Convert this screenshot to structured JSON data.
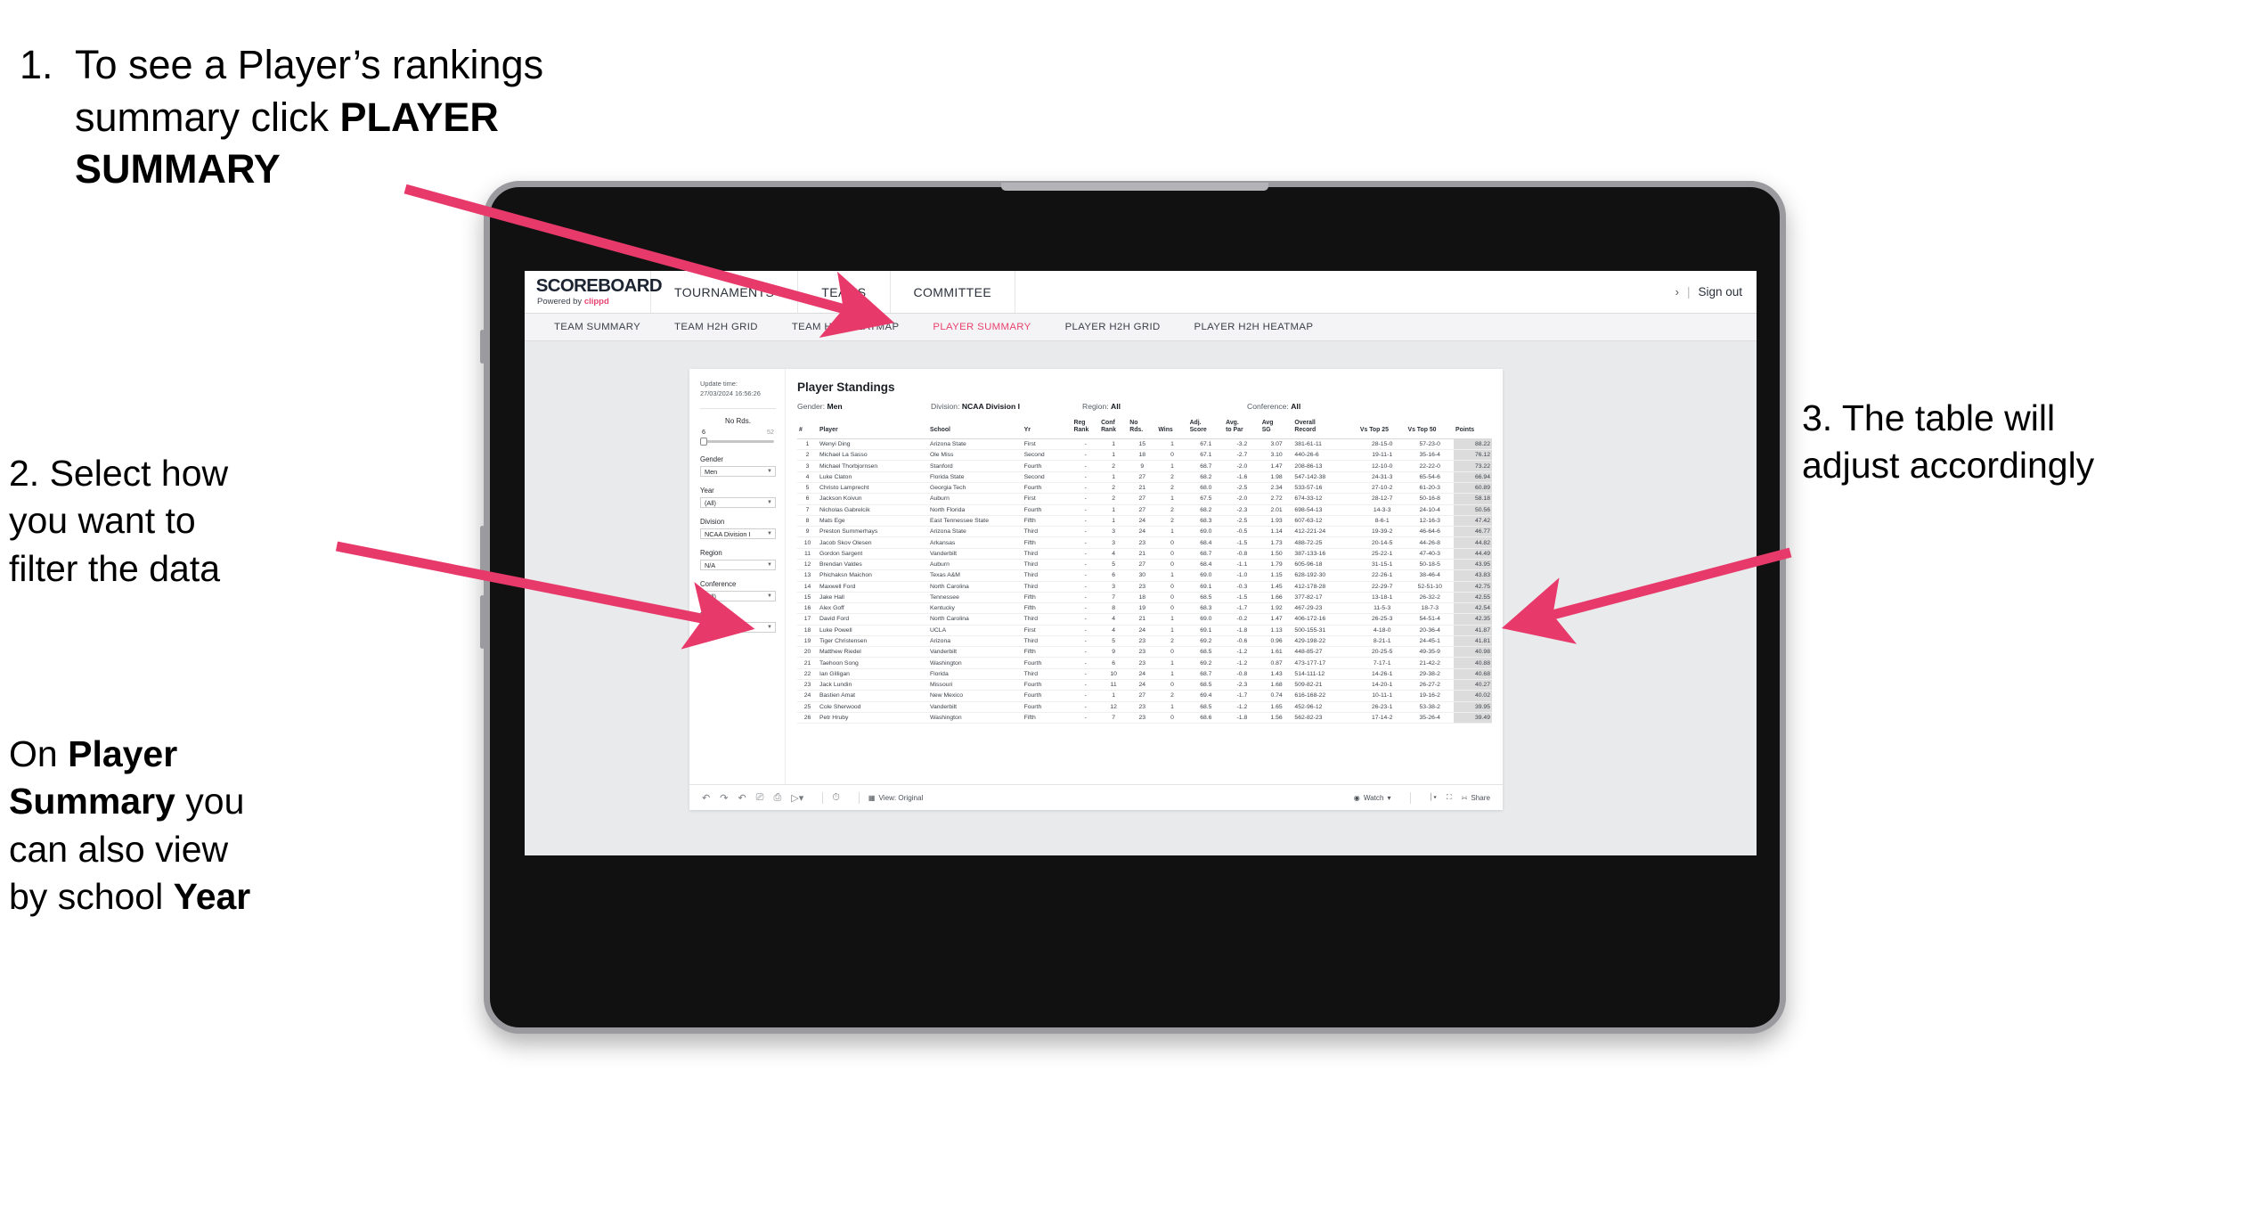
{
  "annotations": {
    "step1": {
      "number": "1.",
      "line1": "To see a Player’s rankings",
      "line2_pre": "summary click ",
      "line2_bold": "PLAYER",
      "line3_bold": "SUMMARY"
    },
    "step2": {
      "line1": "2. Select how",
      "line2": "you want to",
      "line3": "filter the data"
    },
    "step2b": {
      "pre1": "On ",
      "b1": "Player",
      "b2": "Summary",
      "post2": " you",
      "line3": "can also view",
      "line4_pre": "by school ",
      "line4_bold": "Year"
    },
    "step3": {
      "line1": "3. The table will",
      "line2": "adjust accordingly"
    },
    "arrow_color": "#e8396b"
  },
  "app": {
    "logo": {
      "word": "SCOREBOARD",
      "powered_by": "Powered by ",
      "brand": "clippd"
    },
    "top_nav": [
      "TOURNAMENTS",
      "TEAMS",
      "COMMITTEE"
    ],
    "top_right": {
      "chevron": "›",
      "separator": "|",
      "sign_out": "Sign out"
    },
    "sub_tabs": [
      {
        "label": "TEAM SUMMARY",
        "active": false
      },
      {
        "label": "TEAM H2H GRID",
        "active": false
      },
      {
        "label": "TEAM H2H HEATMAP",
        "active": false
      },
      {
        "label": "PLAYER SUMMARY",
        "active": true
      },
      {
        "label": "PLAYER H2H GRID",
        "active": false
      },
      {
        "label": "PLAYER H2H HEATMAP",
        "active": false
      }
    ]
  },
  "filters": {
    "update_label": "Update time:",
    "update_time": "27/03/2024 16:56:26",
    "slider": {
      "title": "No Rds.",
      "min": "6",
      "max": "52"
    },
    "controls": [
      {
        "label": "Gender",
        "value": "Men"
      },
      {
        "label": "Year",
        "value": "(All)"
      },
      {
        "label": "Division",
        "value": "NCAA Division I"
      },
      {
        "label": "Region",
        "value": "N/A"
      },
      {
        "label": "Conference",
        "value": "(All)"
      },
      {
        "label": "Player",
        "value": "(All)"
      }
    ]
  },
  "viz": {
    "title": "Player Standings",
    "filter_summary": [
      {
        "label": "Gender: ",
        "value": "Men"
      },
      {
        "label": "Division: ",
        "value": "NCAA Division I"
      },
      {
        "label": "Region: ",
        "value": "All"
      },
      {
        "label": "Conference: ",
        "value": "All"
      }
    ],
    "columns": [
      "#",
      "Player",
      "School",
      "Yr",
      "Reg Rank",
      "Conf Rank",
      "No Rds.",
      "Wins",
      "Adj. Score",
      "Avg. to Par",
      "Avg SG",
      "Overall Record",
      "Vs Top 25",
      "Vs Top 50",
      "Points"
    ],
    "columns_l1": [
      "#",
      "Player",
      "School",
      "Yr",
      "Reg",
      "Conf",
      "No",
      "Wins",
      "Adj.",
      "Avg.",
      "Avg",
      "Overall",
      "Vs Top 25",
      "Vs Top 50",
      "Points"
    ],
    "columns_l2": [
      "",
      "",
      "",
      "",
      "Rank",
      "Rank",
      "Rds.",
      "",
      "Score",
      "to Par",
      "SG",
      "Record",
      "",
      "",
      ""
    ],
    "rows": [
      [
        "1",
        "Wenyi Ding",
        "Arizona State",
        "First",
        "-",
        "1",
        "15",
        "1",
        "67.1",
        "-3.2",
        "3.07",
        "381-61-11",
        "28-15-0",
        "57-23-0",
        "88.22"
      ],
      [
        "2",
        "Michael La Sasso",
        "Ole Miss",
        "Second",
        "-",
        "1",
        "18",
        "0",
        "67.1",
        "-2.7",
        "3.10",
        "440-26-6",
        "19-11-1",
        "35-16-4",
        "76.12"
      ],
      [
        "3",
        "Michael Thorbjornsen",
        "Stanford",
        "Fourth",
        "-",
        "2",
        "9",
        "1",
        "68.7",
        "-2.0",
        "1.47",
        "208-86-13",
        "12-10-0",
        "22-22-0",
        "73.22"
      ],
      [
        "4",
        "Luke Claton",
        "Florida State",
        "Second",
        "-",
        "1",
        "27",
        "2",
        "68.2",
        "-1.6",
        "1.98",
        "547-142-38",
        "24-31-3",
        "65-54-6",
        "66.94"
      ],
      [
        "5",
        "Christo Lamprecht",
        "Georgia Tech",
        "Fourth",
        "-",
        "2",
        "21",
        "2",
        "68.0",
        "-2.5",
        "2.34",
        "533-57-16",
        "27-10-2",
        "61-20-3",
        "60.89"
      ],
      [
        "6",
        "Jackson Koivun",
        "Auburn",
        "First",
        "-",
        "2",
        "27",
        "1",
        "67.5",
        "-2.0",
        "2.72",
        "674-33-12",
        "28-12-7",
        "50-16-8",
        "58.18"
      ],
      [
        "7",
        "Nicholas Gabrelcik",
        "North Florida",
        "Fourth",
        "-",
        "1",
        "27",
        "2",
        "68.2",
        "-2.3",
        "2.01",
        "698-54-13",
        "14-3-3",
        "24-10-4",
        "50.56"
      ],
      [
        "8",
        "Mats Ege",
        "East Tennessee State",
        "Fifth",
        "-",
        "1",
        "24",
        "2",
        "68.3",
        "-2.5",
        "1.93",
        "607-63-12",
        "8-6-1",
        "12-16-3",
        "47.42"
      ],
      [
        "9",
        "Preston Summerhays",
        "Arizona State",
        "Third",
        "-",
        "3",
        "24",
        "1",
        "69.0",
        "-0.5",
        "1.14",
        "412-221-24",
        "19-39-2",
        "46-64-6",
        "46.77"
      ],
      [
        "10",
        "Jacob Skov Olesen",
        "Arkansas",
        "Fifth",
        "-",
        "3",
        "23",
        "0",
        "68.4",
        "-1.5",
        "1.73",
        "488-72-25",
        "20-14-5",
        "44-26-8",
        "44.82"
      ],
      [
        "11",
        "Gordon Sargent",
        "Vanderbilt",
        "Third",
        "-",
        "4",
        "21",
        "0",
        "68.7",
        "-0.8",
        "1.50",
        "387-133-16",
        "25-22-1",
        "47-40-3",
        "44.49"
      ],
      [
        "12",
        "Brendan Valdes",
        "Auburn",
        "Third",
        "-",
        "5",
        "27",
        "0",
        "68.4",
        "-1.1",
        "1.79",
        "605-96-18",
        "31-15-1",
        "50-18-5",
        "43.95"
      ],
      [
        "13",
        "Phichaksn Maichon",
        "Texas A&M",
        "Third",
        "-",
        "6",
        "30",
        "1",
        "69.0",
        "-1.0",
        "1.15",
        "628-192-30",
        "22-26-1",
        "38-46-4",
        "43.83"
      ],
      [
        "14",
        "Maxwell Ford",
        "North Carolina",
        "Third",
        "-",
        "3",
        "23",
        "0",
        "69.1",
        "-0.3",
        "1.45",
        "412-178-28",
        "22-29-7",
        "52-51-10",
        "42.75"
      ],
      [
        "15",
        "Jake Hall",
        "Tennessee",
        "Fifth",
        "-",
        "7",
        "18",
        "0",
        "68.5",
        "-1.5",
        "1.66",
        "377-82-17",
        "13-18-1",
        "26-32-2",
        "42.55"
      ],
      [
        "16",
        "Alex Goff",
        "Kentucky",
        "Fifth",
        "-",
        "8",
        "19",
        "0",
        "68.3",
        "-1.7",
        "1.92",
        "467-29-23",
        "11-5-3",
        "18-7-3",
        "42.54"
      ],
      [
        "17",
        "David Ford",
        "North Carolina",
        "Third",
        "-",
        "4",
        "21",
        "1",
        "69.0",
        "-0.2",
        "1.47",
        "406-172-16",
        "26-25-3",
        "54-51-4",
        "42.35"
      ],
      [
        "18",
        "Luke Powell",
        "UCLA",
        "First",
        "-",
        "4",
        "24",
        "1",
        "69.1",
        "-1.8",
        "1.13",
        "500-155-31",
        "4-18-0",
        "20-36-4",
        "41.87"
      ],
      [
        "19",
        "Tiger Christensen",
        "Arizona",
        "Third",
        "-",
        "5",
        "23",
        "2",
        "69.2",
        "-0.6",
        "0.96",
        "429-198-22",
        "8-21-1",
        "24-45-1",
        "41.81"
      ],
      [
        "20",
        "Matthew Riedel",
        "Vanderbilt",
        "Fifth",
        "-",
        "9",
        "23",
        "0",
        "68.5",
        "-1.2",
        "1.61",
        "448-85-27",
        "20-25-5",
        "49-35-9",
        "40.98"
      ],
      [
        "21",
        "Taehoon Song",
        "Washington",
        "Fourth",
        "-",
        "6",
        "23",
        "1",
        "69.2",
        "-1.2",
        "0.87",
        "473-177-17",
        "7-17-1",
        "21-42-2",
        "40.88"
      ],
      [
        "22",
        "Ian Gilligan",
        "Florida",
        "Third",
        "-",
        "10",
        "24",
        "1",
        "68.7",
        "-0.8",
        "1.43",
        "514-111-12",
        "14-26-1",
        "29-38-2",
        "40.68"
      ],
      [
        "23",
        "Jack Lundin",
        "Missouri",
        "Fourth",
        "-",
        "11",
        "24",
        "0",
        "68.5",
        "-2.3",
        "1.68",
        "509-82-21",
        "14-20-1",
        "26-27-2",
        "40.27"
      ],
      [
        "24",
        "Bastien Amat",
        "New Mexico",
        "Fourth",
        "-",
        "1",
        "27",
        "2",
        "69.4",
        "-1.7",
        "0.74",
        "616-168-22",
        "10-11-1",
        "19-16-2",
        "40.02"
      ],
      [
        "25",
        "Cole Sherwood",
        "Vanderbilt",
        "Fourth",
        "-",
        "12",
        "23",
        "1",
        "68.5",
        "-1.2",
        "1.65",
        "452-96-12",
        "26-23-1",
        "53-38-2",
        "39.95"
      ],
      [
        "26",
        "Petr Hruby",
        "Washington",
        "Fifth",
        "-",
        "7",
        "23",
        "0",
        "68.6",
        "-1.8",
        "1.56",
        "562-82-23",
        "17-14-2",
        "35-26-4",
        "39.49"
      ]
    ]
  },
  "toolbar": {
    "icons": [
      "undo-icon",
      "redo-icon",
      "revert-icon",
      "refresh-icon",
      "pause-icon",
      "highlight-icon"
    ],
    "view_label": "View: Original",
    "watch_label": "Watch",
    "share_label": "Share"
  }
}
